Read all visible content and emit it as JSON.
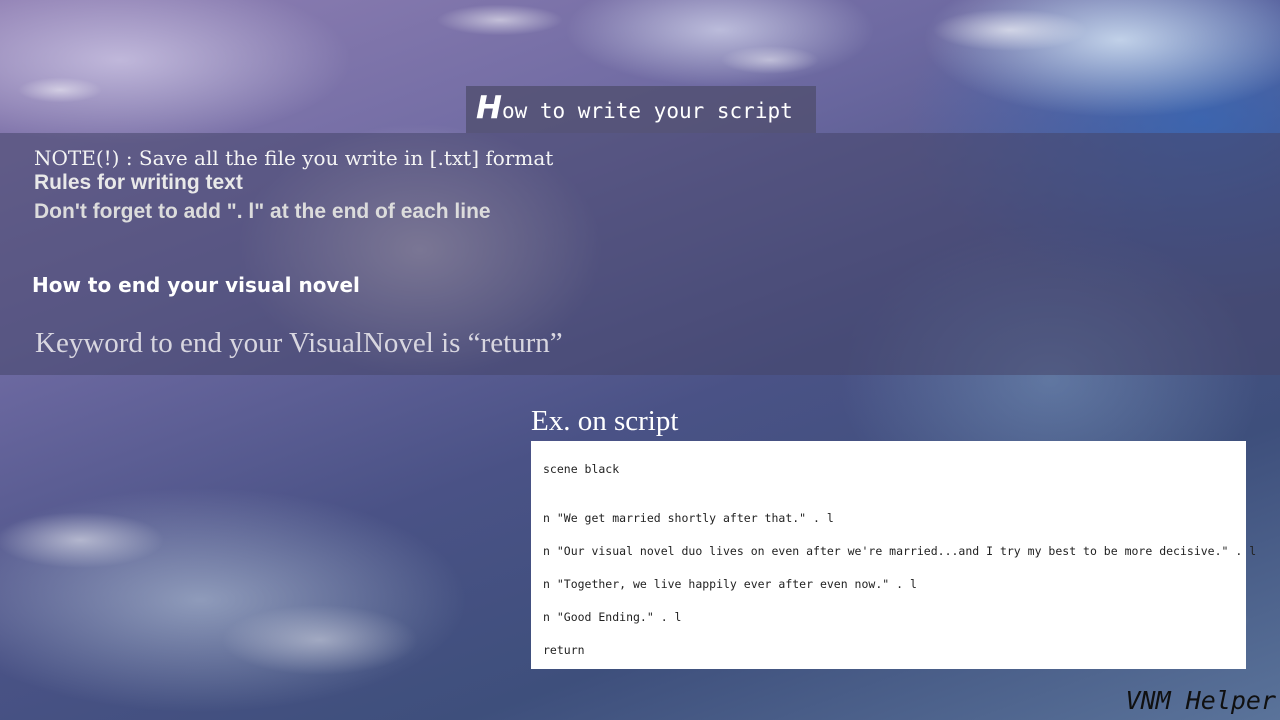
{
  "header": {
    "title_initial": "H",
    "title_rest": "ow to write your script"
  },
  "notes": {
    "save_note": "NOTE(!) : Save all the file you write in [.txt] format",
    "rules_heading": "Rules for writing text",
    "line_rule": "Don't forget to add \". l\" at the end of each line"
  },
  "ending": {
    "heading": "How to end your visual novel",
    "keyword_text": "Keyword to end your VisualNovel is “return”"
  },
  "example": {
    "label": "Ex. on script",
    "lines": [
      "scene black",
      "n \"We get married shortly after that.\" . l",
      "n \"Our visual novel duo lives on even after we're married...and I try my best to be more decisive.\" . l",
      "n \"Together, we live happily ever after even now.\" . l",
      "n \"Good Ending.\" . l",
      "return"
    ]
  },
  "watermark": "VNM Helper"
}
